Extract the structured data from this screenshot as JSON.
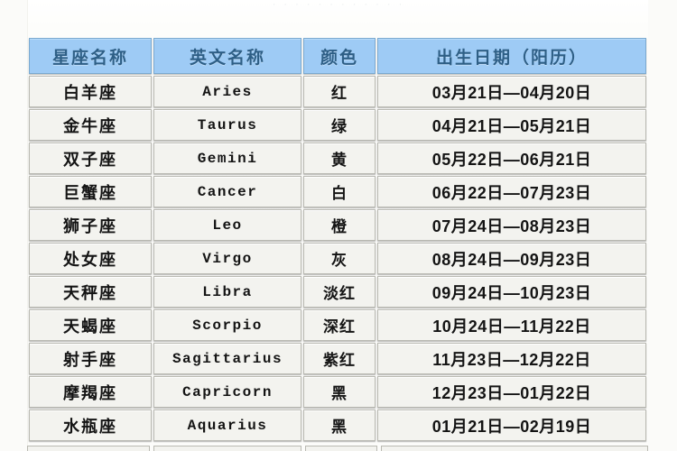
{
  "page": {
    "top_remnant_text": "· · · · · ·   · ·   · · · ·",
    "colors": {
      "header_fill": "#9ECBF5",
      "header_text": "#2E5F86",
      "cell_fill": "#F3F3EF",
      "cell_text": "#141414",
      "cell_border": "#B9B9B2",
      "page_background": "#FFFFFF"
    }
  },
  "table": {
    "headers": [
      {
        "key": "cn_name",
        "label": "星座名称"
      },
      {
        "key": "en_name",
        "label": "英文名称"
      },
      {
        "key": "color",
        "label": "颜色"
      },
      {
        "key": "birth_date",
        "label": "出生日期（阳历）"
      }
    ],
    "rows": [
      {
        "cn_name": "白羊座",
        "en_name": "Aries",
        "color": "红",
        "birth_date": "03月21日—04月20日"
      },
      {
        "cn_name": "金牛座",
        "en_name": "Taurus",
        "color": "绿",
        "birth_date": "04月21日—05月21日"
      },
      {
        "cn_name": "双子座",
        "en_name": "Gemini",
        "color": "黄",
        "birth_date": "05月22日—06月21日"
      },
      {
        "cn_name": "巨蟹座",
        "en_name": "Cancer",
        "color": "白",
        "birth_date": "06月22日—07月23日"
      },
      {
        "cn_name": "狮子座",
        "en_name": "Leo",
        "color": "橙",
        "birth_date": "07月24日—08月23日"
      },
      {
        "cn_name": "处女座",
        "en_name": "Virgo",
        "color": "灰",
        "birth_date": "08月24日—09月23日"
      },
      {
        "cn_name": "天秤座",
        "en_name": "Libra",
        "color": "淡红",
        "birth_date": "09月24日—10月23日"
      },
      {
        "cn_name": "天蝎座",
        "en_name": "Scorpio",
        "color": "深红",
        "birth_date": "10月24日—11月22日"
      },
      {
        "cn_name": "射手座",
        "en_name": "Sagittarius",
        "color": "紫红",
        "birth_date": "11月23日—12月22日"
      },
      {
        "cn_name": "摩羯座",
        "en_name": "Capricorn",
        "color": "黑",
        "birth_date": "12月23日—01月22日"
      },
      {
        "cn_name": "水瓶座",
        "en_name": "Aquarius",
        "color": "黑",
        "birth_date": "01月21日—02月19日"
      }
    ]
  }
}
